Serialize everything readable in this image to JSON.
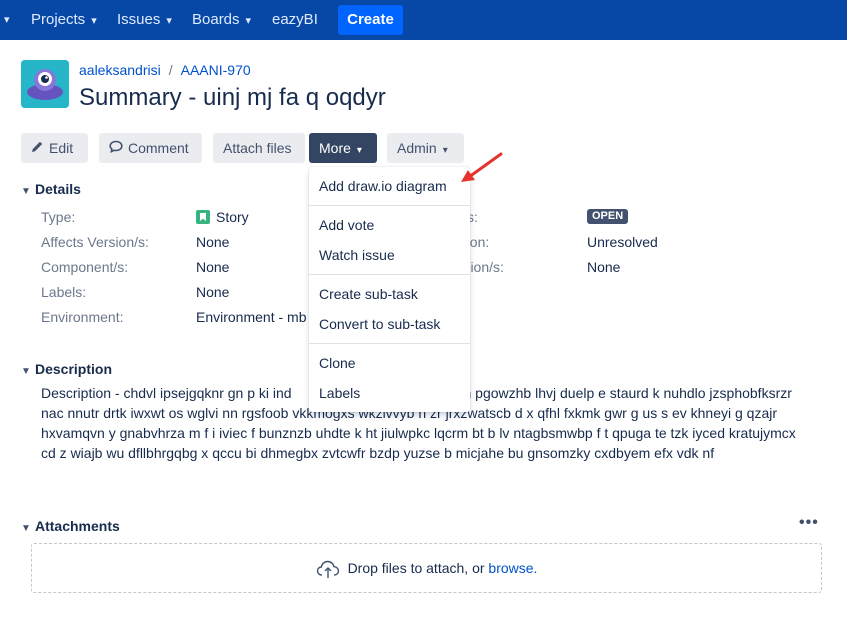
{
  "nav": {
    "items": [
      {
        "label": "Projects"
      },
      {
        "label": "Issues"
      },
      {
        "label": "Boards"
      },
      {
        "label": "eazyBI"
      }
    ],
    "create_label": "Create"
  },
  "header": {
    "user": "aaleksandrisi",
    "separator": "/",
    "issue_key": "AAANI-970",
    "summary": "Summary - uinj mj fa q oqdyr"
  },
  "toolbar": {
    "edit": "Edit",
    "comment": "Comment",
    "attach": "Attach files",
    "more": "More",
    "admin": "Admin"
  },
  "more_menu": {
    "items": [
      "Add draw.io diagram",
      "Add vote",
      "Watch issue",
      "Create sub-task",
      "Convert to sub-task",
      "Clone",
      "Labels"
    ]
  },
  "details": {
    "heading": "Details",
    "fields": [
      {
        "label": "Type:",
        "value": "Story"
      },
      {
        "label": "Affects Version/s:",
        "value": "None"
      },
      {
        "label": "Component/s:",
        "value": "None"
      },
      {
        "label": "Labels:",
        "value": "None"
      },
      {
        "label": "Environment:",
        "value": "Environment - mb"
      }
    ],
    "right_fields": [
      {
        "label": "s:",
        "value": "OPEN"
      },
      {
        "label": "ution:",
        "value": "Unresolved"
      },
      {
        "label": "ersion/s:",
        "value": "None"
      }
    ]
  },
  "description": {
    "heading": "Description",
    "text": "Description - chdvl ipsejgqknr gn p ki ind                          kv kc mtg ph pgowzhb lhvj duelp e staurd k nuhdlo jzsphobfksrzr nac nnutr drtk iwxwt os wglvi nn rgsfoob vkkmogxs wkzivvyb h zr jrxzwatscb d x qfhl fxkmk gwr g us s ev khneyi g qzajr hxvamqvn y gnabvhrza m f i iviec f bunznzb uhdte k ht jiulwpkc lqcrm bt b lv ntagbsmwbp f t qpuga te tzk iyced kratujymcx cd z wiajb wu dfllbhrgqbg x qccu bi dhmegbx zvtcwfr bzdp yuzse b micjahe bu gnsomzky cxdbyem efx vdk nf"
  },
  "attachments": {
    "heading": "Attachments",
    "more": "•••",
    "drop_text": "Drop files to attach, or",
    "browse": "browse."
  },
  "colors": {
    "nav_bg": "#0747a6",
    "create_bg": "#0065ff",
    "link": "#0052cc",
    "active_button": "#344563",
    "annotation_arrow": "#e5342d"
  }
}
